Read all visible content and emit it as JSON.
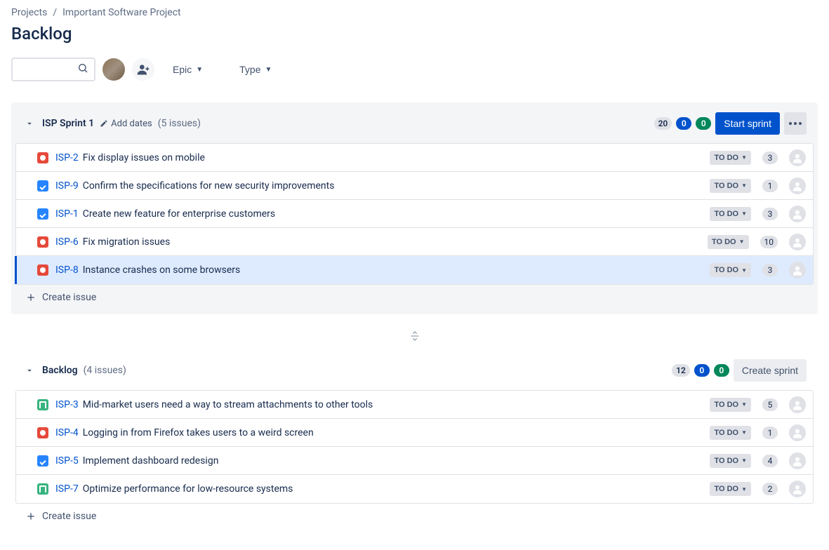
{
  "breadcrumb": {
    "root": "Projects",
    "project": "Important Software Project"
  },
  "page_title": "Backlog",
  "toolbar": {
    "search_placeholder": "",
    "epic_label": "Epic",
    "type_label": "Type"
  },
  "sprint": {
    "name": "ISP Sprint 1",
    "add_dates_label": "Add dates",
    "issue_count_label": "(5 issues)",
    "totals": {
      "todo": "20",
      "in_progress": "0",
      "done": "0"
    },
    "start_button": "Start sprint",
    "issues": [
      {
        "type": "bug",
        "key": "ISP-2",
        "summary": "Fix display issues on mobile",
        "status": "TO DO",
        "points": "3",
        "selected": false
      },
      {
        "type": "task",
        "key": "ISP-9",
        "summary": "Confirm the specifications for new security improvements",
        "status": "TO DO",
        "points": "1",
        "selected": false
      },
      {
        "type": "task",
        "key": "ISP-1",
        "summary": "Create new feature for enterprise customers",
        "status": "TO DO",
        "points": "3",
        "selected": false
      },
      {
        "type": "bug",
        "key": "ISP-6",
        "summary": "Fix migration issues",
        "status": "TO DO",
        "points": "10",
        "selected": false
      },
      {
        "type": "bug",
        "key": "ISP-8",
        "summary": "Instance crashes on some browsers",
        "status": "TO DO",
        "points": "3",
        "selected": true
      }
    ],
    "create_issue_label": "Create issue"
  },
  "backlog": {
    "name": "Backlog",
    "issue_count_label": "(4 issues)",
    "totals": {
      "todo": "12",
      "in_progress": "0",
      "done": "0"
    },
    "create_sprint_button": "Create sprint",
    "issues": [
      {
        "type": "story",
        "key": "ISP-3",
        "summary": "Mid-market users need a way to stream attachments to other tools",
        "status": "TO DO",
        "points": "5",
        "selected": false
      },
      {
        "type": "bug",
        "key": "ISP-4",
        "summary": "Logging in from Firefox takes users to a weird screen",
        "status": "TO DO",
        "points": "1",
        "selected": false
      },
      {
        "type": "task",
        "key": "ISP-5",
        "summary": "Implement dashboard redesign",
        "status": "TO DO",
        "points": "4",
        "selected": false
      },
      {
        "type": "story",
        "key": "ISP-7",
        "summary": "Optimize performance for low-resource systems",
        "status": "TO DO",
        "points": "2",
        "selected": false
      }
    ],
    "create_issue_label": "Create issue"
  }
}
